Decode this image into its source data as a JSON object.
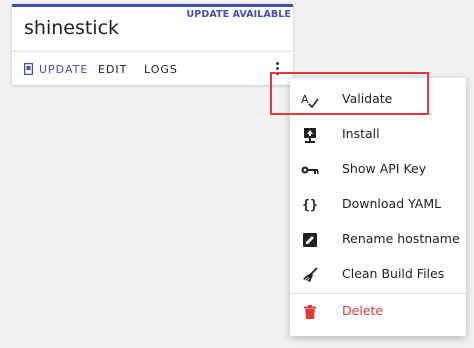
{
  "card": {
    "title": "shinestick",
    "badge": "UPDATE AVAILABLE",
    "actions": {
      "update": "UPDATE",
      "edit": "EDIT",
      "logs": "LOGS"
    }
  },
  "menu": {
    "items": [
      {
        "label": "Validate",
        "icon": "spellcheck-icon"
      },
      {
        "label": "Install",
        "icon": "upload-icon"
      },
      {
        "label": "Show API Key",
        "icon": "key-icon"
      },
      {
        "label": "Download YAML",
        "icon": "code-braces-icon"
      },
      {
        "label": "Rename hostname",
        "icon": "rename-icon"
      },
      {
        "label": "Clean Build Files",
        "icon": "broom-icon"
      },
      {
        "label": "Delete",
        "icon": "trash-icon"
      }
    ]
  },
  "colors": {
    "accent": "#3f51b5",
    "danger": "#e53935",
    "highlight_border": "#e53935"
  }
}
